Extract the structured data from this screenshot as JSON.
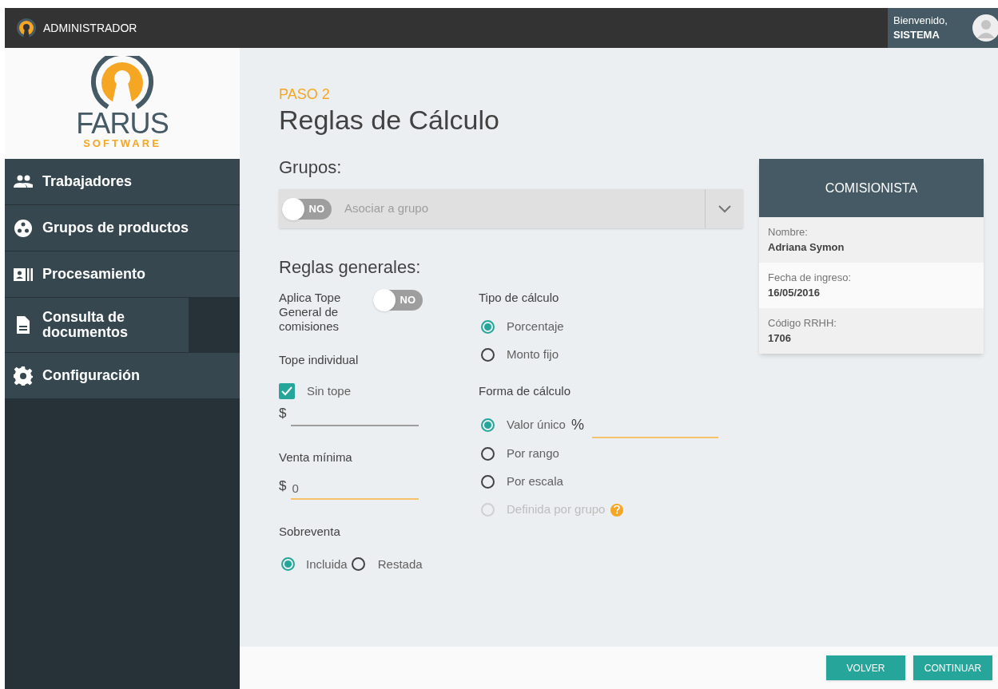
{
  "header": {
    "role": "ADMINISTRADOR",
    "greeting": "Bienvenido,",
    "user": "SISTEMA"
  },
  "logo": {
    "name": "FARUS",
    "tagline": "SOFTWARE"
  },
  "sidebar": {
    "items": [
      {
        "label": "Trabajadores",
        "kind": "people"
      },
      {
        "label": "Grupos de productos",
        "kind": "group"
      },
      {
        "label": "Procesamiento",
        "kind": "process"
      },
      {
        "label": "Consulta de documentos",
        "kind": "document"
      },
      {
        "label": "Configuración",
        "kind": "settings"
      }
    ]
  },
  "step": "PASO 2",
  "title": "Reglas de Cálculo",
  "groups": {
    "heading": "Grupos:",
    "toggle": {
      "label": "NO",
      "on": false
    },
    "placeholder": "Asociar a grupo"
  },
  "general": {
    "heading": "Reglas generales:",
    "tope_general": {
      "label": "Aplica Tope General de comisiones",
      "toggle": {
        "label": "NO",
        "on": false
      }
    },
    "tope_individual": {
      "heading": "Tope individual",
      "checkbox": {
        "label": "Sin tope",
        "checked": true
      },
      "currency": "$",
      "disabled": true
    },
    "venta_minima": {
      "heading": "Venta mínima",
      "currency": "$",
      "value": "0",
      "disabled": false
    },
    "sobreventa": {
      "heading": "Sobreventa",
      "options": [
        {
          "label": "Incluida",
          "selected": true
        },
        {
          "label": "Restada",
          "selected": false
        }
      ]
    },
    "tipo_calculo": {
      "heading": "Tipo de cálculo",
      "options": [
        {
          "label": "Porcentaje",
          "selected": true,
          "disabled": false
        },
        {
          "label": "Monto fijo",
          "selected": false,
          "disabled": false
        }
      ]
    },
    "forma_calculo": {
      "heading": "Forma de cálculo",
      "options": [
        {
          "label": "Valor único",
          "selected": true,
          "disabled": false,
          "unit": "%"
        },
        {
          "label": "Por rango",
          "selected": false,
          "disabled": false
        },
        {
          "label": "Por escala",
          "selected": false,
          "disabled": false
        },
        {
          "label": "Definida por grupo",
          "selected": false,
          "disabled": true,
          "help": true
        }
      ]
    }
  },
  "card": {
    "title": "COMISIONISTA",
    "fields": [
      {
        "label": "Nombre:",
        "value": "Adriana Symon"
      },
      {
        "label": "Fecha de ingreso:",
        "value": "16/05/2016"
      },
      {
        "label": "Código RRHH:",
        "value": "1706"
      }
    ]
  },
  "buttons": [
    {
      "label": "VOLVER"
    },
    {
      "label": "CONTINUAR"
    }
  ]
}
